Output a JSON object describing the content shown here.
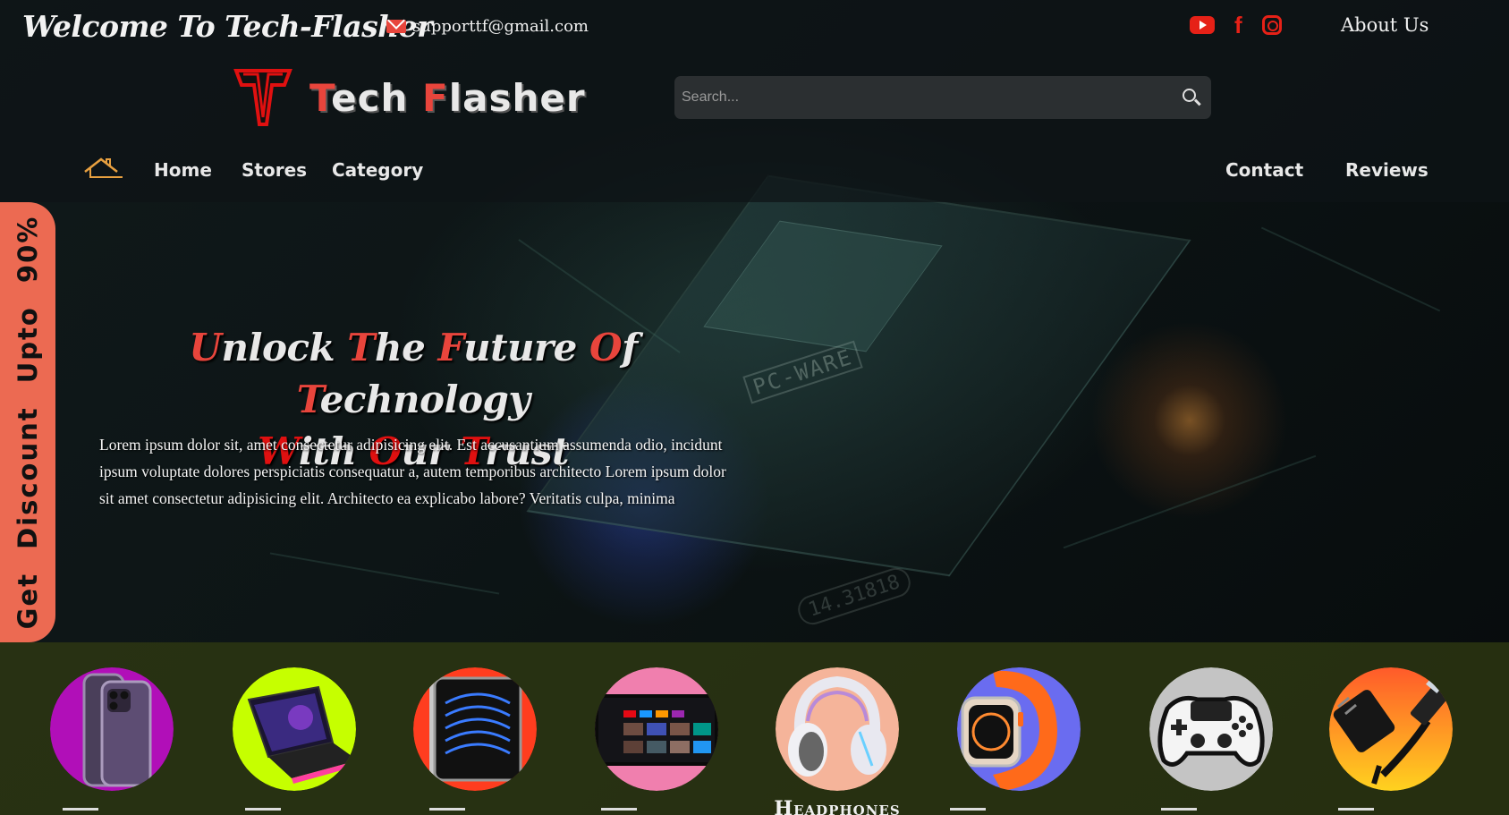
{
  "header": {
    "welcome": "Welcome To Tech-Flasher",
    "email": "supporttf@gmail.com",
    "about_label": "About Us",
    "social_icons": [
      "youtube-icon",
      "facebook-icon",
      "instagram-icon"
    ],
    "accent_color": "#e8453c"
  },
  "brand": {
    "first_initial": "T",
    "first_rest": "ech",
    "second_initial": "F",
    "second_rest": "lasher"
  },
  "search": {
    "placeholder": "Search..."
  },
  "nav": {
    "home": "Home",
    "stores": "Stores",
    "category": "Category",
    "contact": "Contact",
    "reviews": "Reviews"
  },
  "discount_tab": {
    "text": "Get Discount Upto 90%",
    "color": "#ec6a52"
  },
  "hero": {
    "line1_words": [
      {
        "initial": "U",
        "rest": "nlock"
      },
      {
        "initial": "T",
        "rest": "he"
      },
      {
        "initial": "F",
        "rest": "uture"
      },
      {
        "initial": "O",
        "rest": "f"
      },
      {
        "initial": "T",
        "rest": "echnology"
      }
    ],
    "line2_words": [
      {
        "initial": "W",
        "rest": "ith"
      },
      {
        "initial": "O",
        "rest": "ur"
      },
      {
        "initial": "T",
        "rest": "rust"
      }
    ],
    "paragraph": "Lorem ipsum dolor sit, amet consectetur adipisicing elit. Est accusantium assumenda odio, incidunt ipsum voluptate dolores perspiciatis consequatur a, autem temporibus architecto Lorem ipsum dolor sit amet consectetur adipisicing elit. Architecto ea explicabo labore? Veritatis culpa, minima"
  },
  "categories": [
    {
      "icon": "smartphone-icon",
      "bg": "#b10fb8",
      "label": ""
    },
    {
      "icon": "laptop-icon",
      "bg": "#c6ff00",
      "label": ""
    },
    {
      "icon": "tablet-icon",
      "bg": "#ff3d1f",
      "label": ""
    },
    {
      "icon": "tv-icon",
      "bg": "#f07fae",
      "label": ""
    },
    {
      "icon": "headphones-icon",
      "bg": "#f5b49a",
      "label": "Headphones"
    },
    {
      "icon": "smartwatch-icon",
      "bg": "#6a6cf0",
      "label": ""
    },
    {
      "icon": "gamepad-icon",
      "bg": "#c4c4c4",
      "label": ""
    },
    {
      "icon": "charger-icon",
      "bg": "#ffb300",
      "label": ""
    }
  ]
}
